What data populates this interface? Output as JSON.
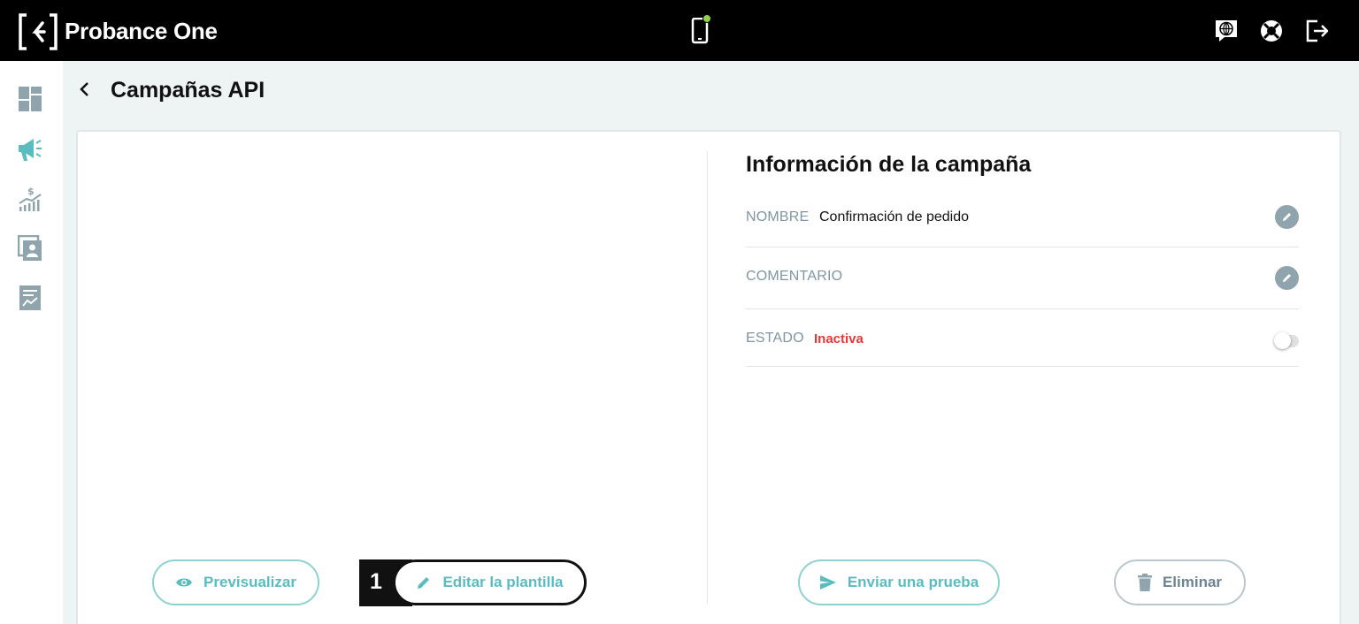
{
  "app": {
    "brand": "Probance One"
  },
  "header": {
    "title": "Campañas API"
  },
  "info": {
    "title": "Información de la campaña",
    "nombre_label": "NOMBRE",
    "nombre_value": "Confirmación de pedido",
    "comentario_label": "COMENTARIO",
    "estado_label": "ESTADO",
    "estado_value": "Inactiva"
  },
  "actions": {
    "preview": "Previsualizar",
    "edit_template": "Editar la plantilla",
    "edit_badge": "1",
    "send_test": "Enviar una prueba",
    "delete": "Eliminar"
  },
  "icons": {
    "topbar": [
      "phone-icon",
      "chat-globe-icon",
      "lifebuoy-icon",
      "logout-icon"
    ],
    "sidebar": [
      "dashboard-icon",
      "megaphone-icon",
      "revenue-chart-icon",
      "contacts-icon",
      "report-icon"
    ]
  },
  "colors": {
    "accent": "#5bbcbf",
    "status_inactive": "#e53935",
    "online_dot": "#8ed34b"
  }
}
